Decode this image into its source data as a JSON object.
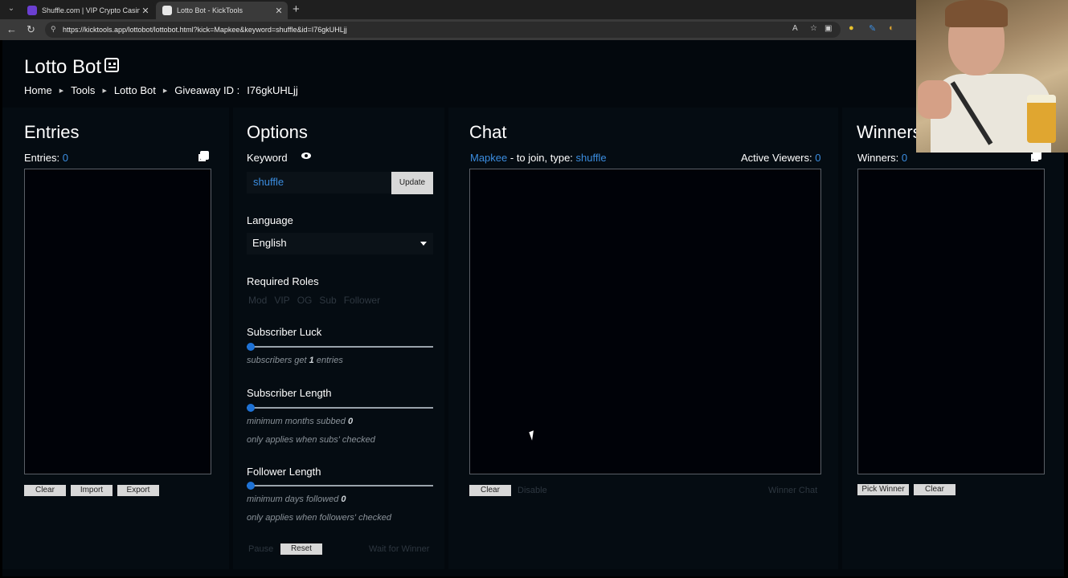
{
  "browser": {
    "tabs": [
      {
        "title": "Shuffle.com | VIP Crypto Casino &",
        "favicon_color": "#6b3fd1"
      },
      {
        "title": "Lotto Bot - KickTools",
        "favicon_color": "#e8e8e8"
      }
    ],
    "url": "https://kicktools.app/lottobot/lottobot.html?kick=Mapkee&keyword=shuffle&id=I76gkUHLjj"
  },
  "page": {
    "title": "Lotto Bot",
    "breadcrumbs": [
      "Home",
      "Tools",
      "Lotto Bot"
    ],
    "giveaway_label": "Giveaway ID :",
    "giveaway_id": "I76gkUHLjj"
  },
  "entries": {
    "title": "Entries",
    "count_label": "Entries:",
    "count": "0",
    "buttons": {
      "clear": "Clear",
      "import": "Import",
      "export": "Export"
    }
  },
  "options": {
    "title": "Options",
    "keyword_label": "Keyword",
    "keyword_value": "shuffle",
    "update_label": "Update",
    "language_label": "Language",
    "language_value": "English",
    "roles_label": "Required Roles",
    "roles": [
      "Mod",
      "VIP",
      "OG",
      "Sub",
      "Follower"
    ],
    "sub_luck_label": "Subscriber Luck",
    "sub_luck_value": 0,
    "sub_luck_hint_pre": "subscribers get",
    "sub_luck_hint_num": "1",
    "sub_luck_hint_post": "entries",
    "sub_length_label": "Subscriber Length",
    "sub_length_value": 0,
    "sub_length_hint_pre": "minimum months subbed",
    "sub_length_hint_num": "0",
    "sub_length_note": "only applies when subs' checked",
    "follower_length_label": "Follower Length",
    "follower_length_value": 0,
    "follower_length_hint_pre": "minimum days followed",
    "follower_length_hint_num": "0",
    "follower_length_note": "only applies when followers' checked",
    "pause_label": "Pause",
    "reset_label": "Reset",
    "wait_label": "Wait for Winner"
  },
  "chat": {
    "title": "Chat",
    "channel": "Mapkee",
    "join_text": "- to join, type:",
    "keyword": "shuffle",
    "viewers_label": "Active Viewers:",
    "viewers": "0",
    "clear_label": "Clear",
    "disable_label": "Disable",
    "winner_chat_label": "Winner Chat"
  },
  "winners": {
    "title": "Winners",
    "count_label": "Winners:",
    "count": "0",
    "pick_label": "Pick Winner",
    "clear_label": "Clear"
  },
  "colors": {
    "accent": "#3b8de0",
    "slider_thumb": "#1e72d6",
    "background": "#03080d"
  }
}
